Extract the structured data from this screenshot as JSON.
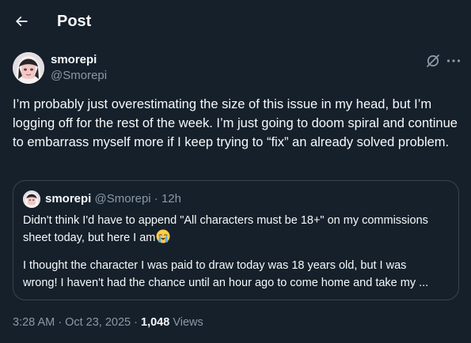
{
  "header": {
    "title": "Post"
  },
  "tweet": {
    "author_name": "smorepi",
    "author_handle": "@Smorepi",
    "text": "I’m probably just overestimating the size of this issue in my head, but I’m logging off for the rest of the week. I’m just going to doom spiral and continue to embarrass myself more if I keep trying to “fix” an already solved problem.",
    "time": "3:28 AM",
    "date": "Oct 23, 2025",
    "views_count": "1,048",
    "views_label": "Views"
  },
  "quote": {
    "author_name": "smorepi",
    "author_handle": "@Smorepi",
    "time_ago": "12h",
    "paragraph1": "Didn't think I'd have to append \"All characters must be 18+\" on my commissions sheet today, but here I am",
    "paragraph2a": "I thought the character I was paid to draw today was 18 years old, but I was",
    "paragraph2b": "wrong! I haven't had the chance until an hour ago to come home and take my ...",
    "emoji": "loudly-crying-face"
  },
  "icons": {
    "back": "arrow-left-icon",
    "grok": "grok-icon",
    "more": "more-icon"
  },
  "colors": {
    "background": "#15202b",
    "text_primary": "#f7f9f9",
    "text_secondary": "#8b98a5",
    "border": "#38444d"
  }
}
